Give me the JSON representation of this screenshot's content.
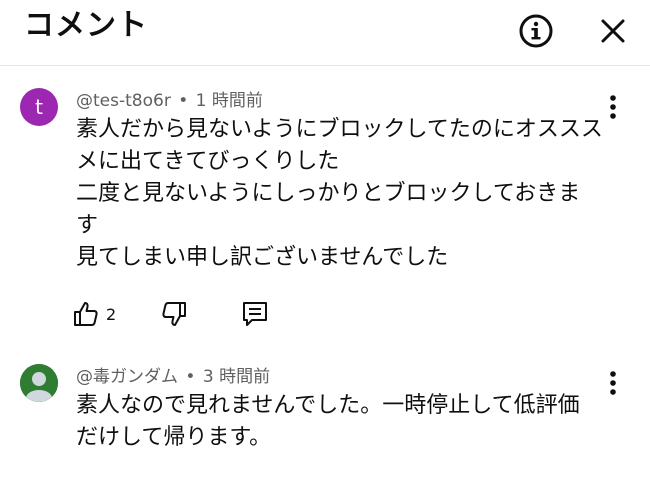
{
  "header": {
    "title": "コメント",
    "info_icon": "info-circle-icon",
    "close_icon": "close-icon"
  },
  "comments": [
    {
      "avatar_letter": "t",
      "avatar_color": "#9c27b0",
      "author": "@tes-t8o6r",
      "separator": "•",
      "time": "1 時間前",
      "lines": [
        "素人だから見ないようにブロックしてたのにオススス",
        "メに出てきてびっくりした",
        "二度と見ないようにしっかりとブロックしておきま",
        "す",
        "見てしまい申し訳ございませんでした"
      ],
      "likes": "2"
    },
    {
      "avatar_color": "#2e7d32",
      "author": "@毒ガンダム",
      "separator": "•",
      "time": "3 時間前",
      "lines": [
        "素人なので見れませんでした。一時停止して低評価",
        "だけして帰ります。"
      ]
    }
  ],
  "colors": {
    "text": "#0f0f0f",
    "meta": "#606060",
    "divider": "#e5e5e5"
  }
}
